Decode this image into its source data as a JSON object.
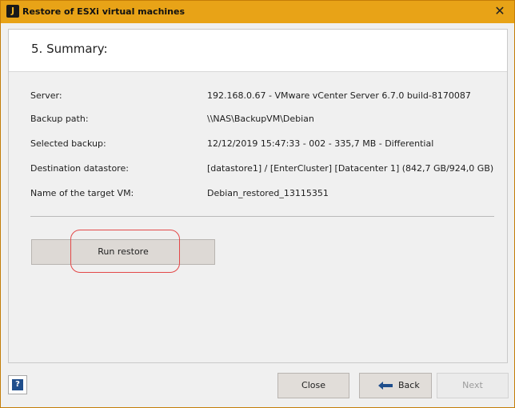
{
  "window": {
    "title": "Restore of ESXi virtual machines",
    "close_glyph": "✕",
    "app_icon": "j-logo-icon",
    "accent": "#e8a317"
  },
  "step": {
    "title": "5. Summary:"
  },
  "summary": {
    "rows": [
      {
        "label": "Server:",
        "value": "192.168.0.67 - VMware vCenter Server 6.7.0 build-8170087"
      },
      {
        "label": "Backup path:",
        "value": "\\\\NAS\\BackupVM\\Debian"
      },
      {
        "label": "Selected backup:",
        "value": "12/12/2019 15:47:33 - 002 - 335,7 MB - Differential"
      },
      {
        "label": "Destination datastore:",
        "value": "[datastore1] / [EnterCluster] [Datacenter 1] (842,7 GB/924,0 GB)"
      },
      {
        "label": "Name of the target VM:",
        "value": "Debian_restored_13115351"
      }
    ]
  },
  "actions": {
    "run_restore": "Run restore"
  },
  "footer": {
    "help_glyph": "?",
    "close_label": "Close",
    "back_label": "Back",
    "next_label": "Next"
  }
}
